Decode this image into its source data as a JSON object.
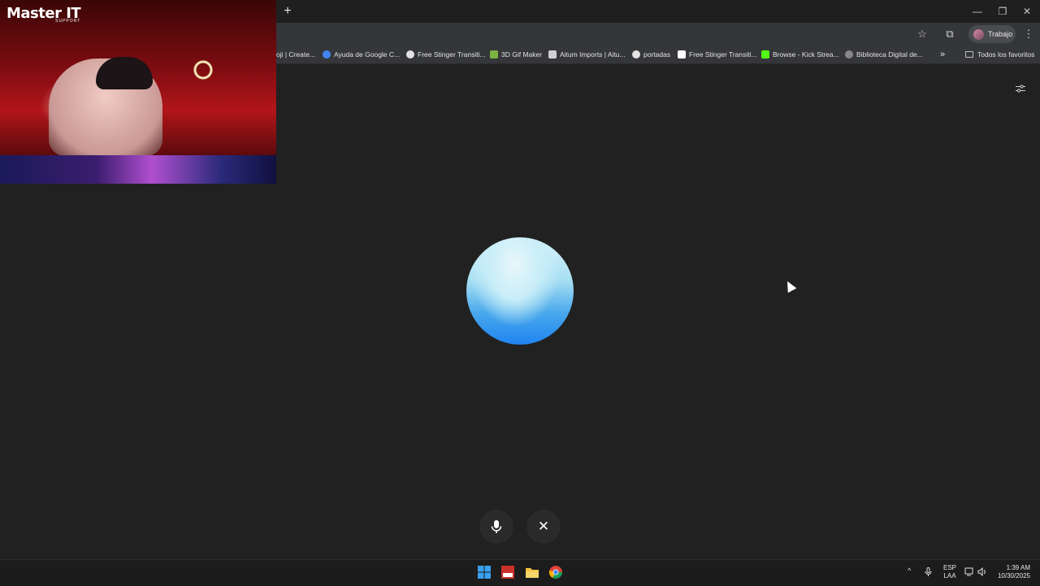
{
  "window": {
    "new_tab": "+",
    "minimize": "—",
    "restore": "❐",
    "close": "✕"
  },
  "toolbar": {
    "star_icon": "☆",
    "extensions_icon": "⧉",
    "profile_label": "Trabajo",
    "menu_icon": "⋮"
  },
  "bookmarks": [
    {
      "label": "oji | Create...",
      "color": "#9aa0a6"
    },
    {
      "label": "Ayuda de Google C...",
      "color": "#4285f4"
    },
    {
      "label": "Free Stinger Transiti...",
      "color": "#e3e3e3"
    },
    {
      "label": "3D Gif Maker",
      "color": "#7cb342"
    },
    {
      "label": "Aitum Imports | Aitu...",
      "color": "#d0d0d0"
    },
    {
      "label": "portadas",
      "color": "#e3e3e3"
    },
    {
      "label": "Free Stinger Transiti...",
      "color": "#ffffff"
    },
    {
      "label": "Browse - Kick Strea...",
      "color": "#53fc18"
    },
    {
      "label": "Biblioteca Digital de...",
      "color": "#888888"
    }
  ],
  "bookmarks_overflow": "»",
  "all_bookmarks": "Todos los favoritos",
  "webcam": {
    "logo_main": "Master IT",
    "logo_sub": "SUPPORT"
  },
  "controls": {
    "mic_label": "microphone",
    "close_label": "✕"
  },
  "taskbar": {
    "apps": [
      "windows-start",
      "video-writer",
      "file-explorer",
      "chrome"
    ],
    "tray_chevron": "^",
    "lang_line1": "ESP",
    "lang_line2": "LAA",
    "time": "1:39 AM",
    "date": "10/30/2025"
  }
}
